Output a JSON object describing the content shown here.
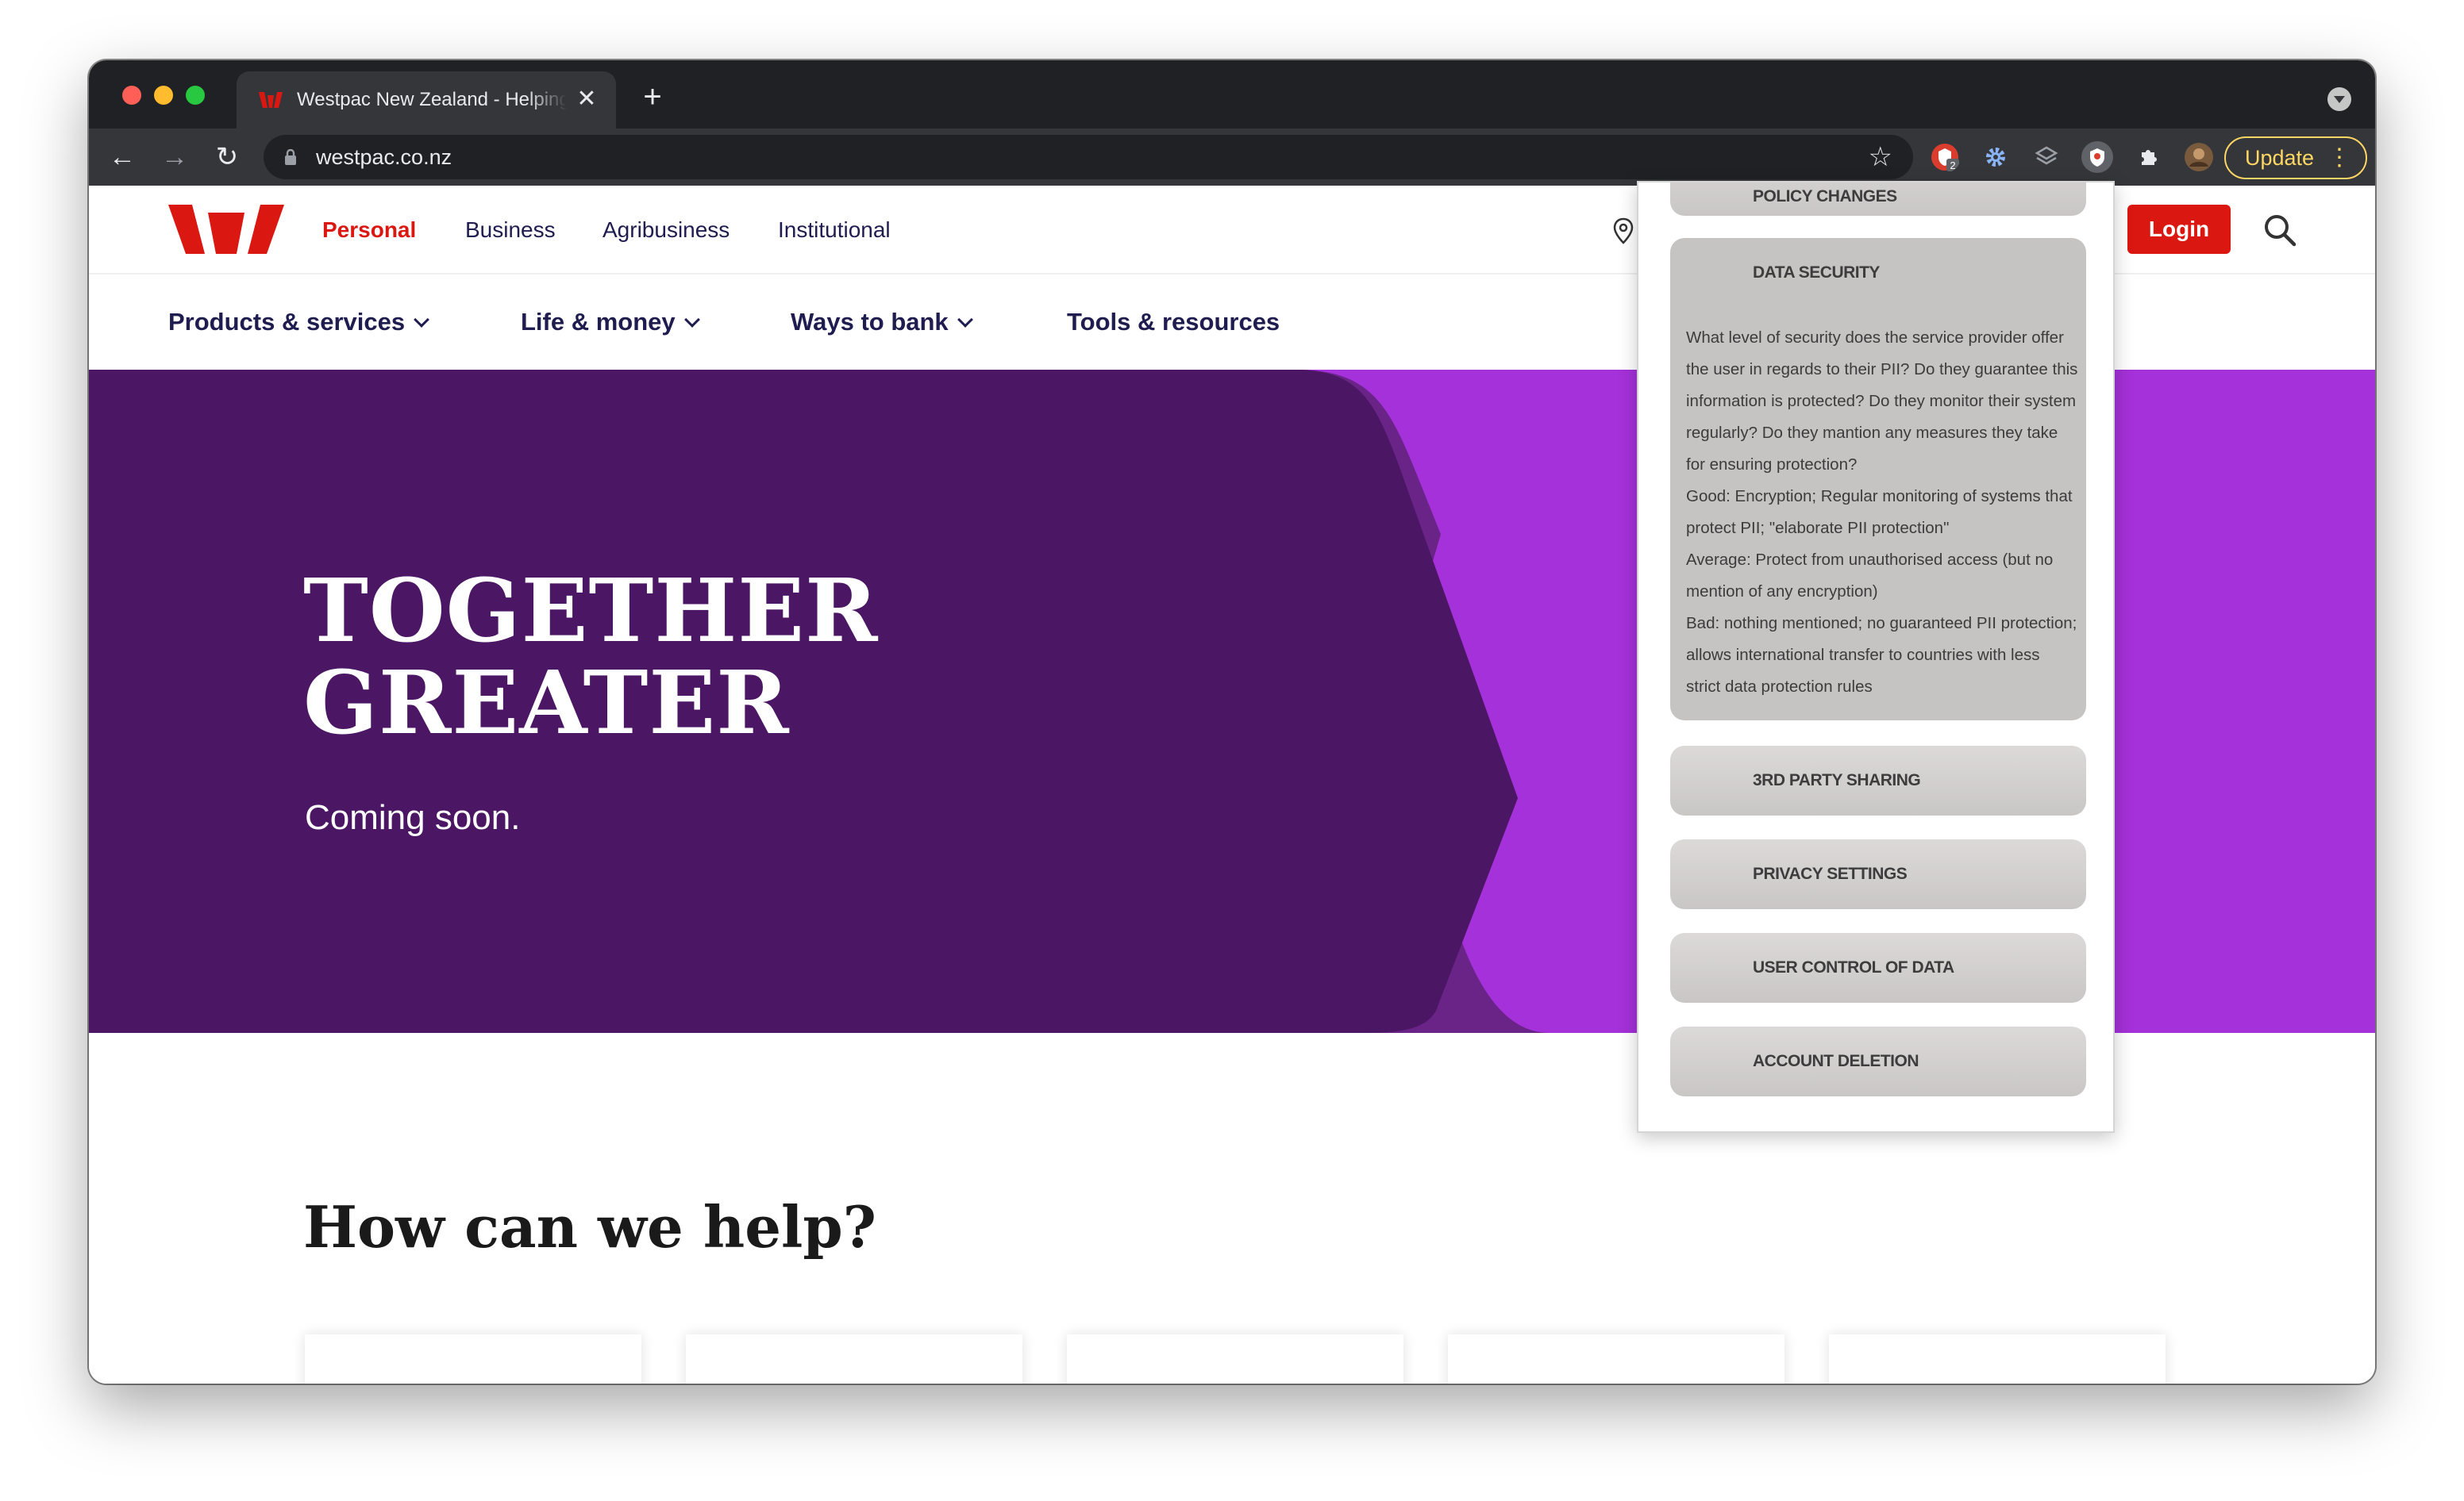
{
  "browser": {
    "tab_title": "Westpac New Zealand - Helping you",
    "close_glyph": "✕",
    "newtab_glyph": "+",
    "url": "westpac.co.nz",
    "update_label": "Update",
    "back_glyph": "←",
    "forward_glyph": "→",
    "reload_glyph": "↻",
    "star_glyph": "☆",
    "menu_glyph": "⋮",
    "extension_badge": "2",
    "extensions": [
      "shield-extension-icon",
      "gear-extension-icon",
      "layers-extension-icon",
      "privacy-extension-icon",
      "puzzle-extensions-icon",
      "profile-avatar"
    ]
  },
  "site": {
    "segments": [
      "Personal",
      "Business",
      "Agribusiness",
      "Institutional"
    ],
    "active_segment": "Personal",
    "login_label": "Login",
    "main_nav": [
      "Products & services",
      "Life & money",
      "Ways to bank",
      "Tools & resources"
    ],
    "hero": {
      "title_line1": "TOGETHER",
      "title_line2": "GREATER",
      "subtitle": "Coming soon."
    },
    "help_title": "How can we help?",
    "colors": {
      "brand_red": "#da1710",
      "hero_dark": "#4b1663",
      "hero_mid": "#6a2387",
      "hero_light": "#a431d9"
    }
  },
  "popup": {
    "partial_top_label": "POLICY CHANGES",
    "expanded": {
      "label": "DATA SECURITY",
      "description": [
        "What level of security does the service provider offer the user in regards to their PII? Do they guarantee this information is protected? Do they monitor their system regularly? Do they mantion any measures they take for ensuring protection?",
        "Good: Encryption; Regular monitoring of systems that protect PII; \"elaborate PII protection\"",
        "Average: Protect from unauthorised access (but no mention of any encryption)",
        "Bad: nothing mentioned; no guaranteed PII protection; allows international transfer to countries with less strict data protection rules"
      ]
    },
    "categories": [
      "3RD PARTY SHARING",
      "PRIVACY SETTINGS",
      "USER CONTROL OF DATA",
      "ACCOUNT DELETION"
    ]
  }
}
